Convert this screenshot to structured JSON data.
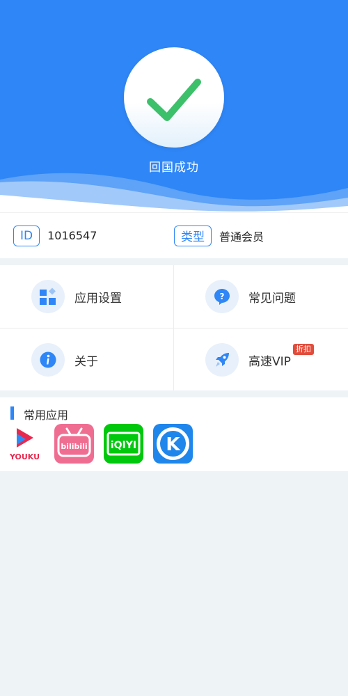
{
  "header": {
    "status_text": "回国成功",
    "background_color": "#2f86f6",
    "icon": "check-icon"
  },
  "account": {
    "id_label": "ID",
    "id_value": "1016547",
    "type_label": "类型",
    "type_value": "普通会员"
  },
  "menu": {
    "items": [
      {
        "label": "应用设置",
        "icon": "grid-settings-icon"
      },
      {
        "label": "常见问题",
        "icon": "question-icon"
      },
      {
        "label": "关于",
        "icon": "info-icon"
      },
      {
        "label": "高速VIP",
        "icon": "rocket-icon",
        "badge": "折扣"
      }
    ]
  },
  "apps": {
    "title": "常用应用",
    "items": [
      {
        "name": "Youku",
        "icon_text": "YOUKU"
      },
      {
        "name": "Bilibili",
        "icon_text": "bilibili"
      },
      {
        "name": "iQIYI",
        "icon_text": "iQIYI"
      },
      {
        "name": "Kugou",
        "icon_text": "K"
      }
    ]
  },
  "colors": {
    "accent": "#2f86f6",
    "check": "#3cc06a",
    "badge": "#e24c3b"
  }
}
